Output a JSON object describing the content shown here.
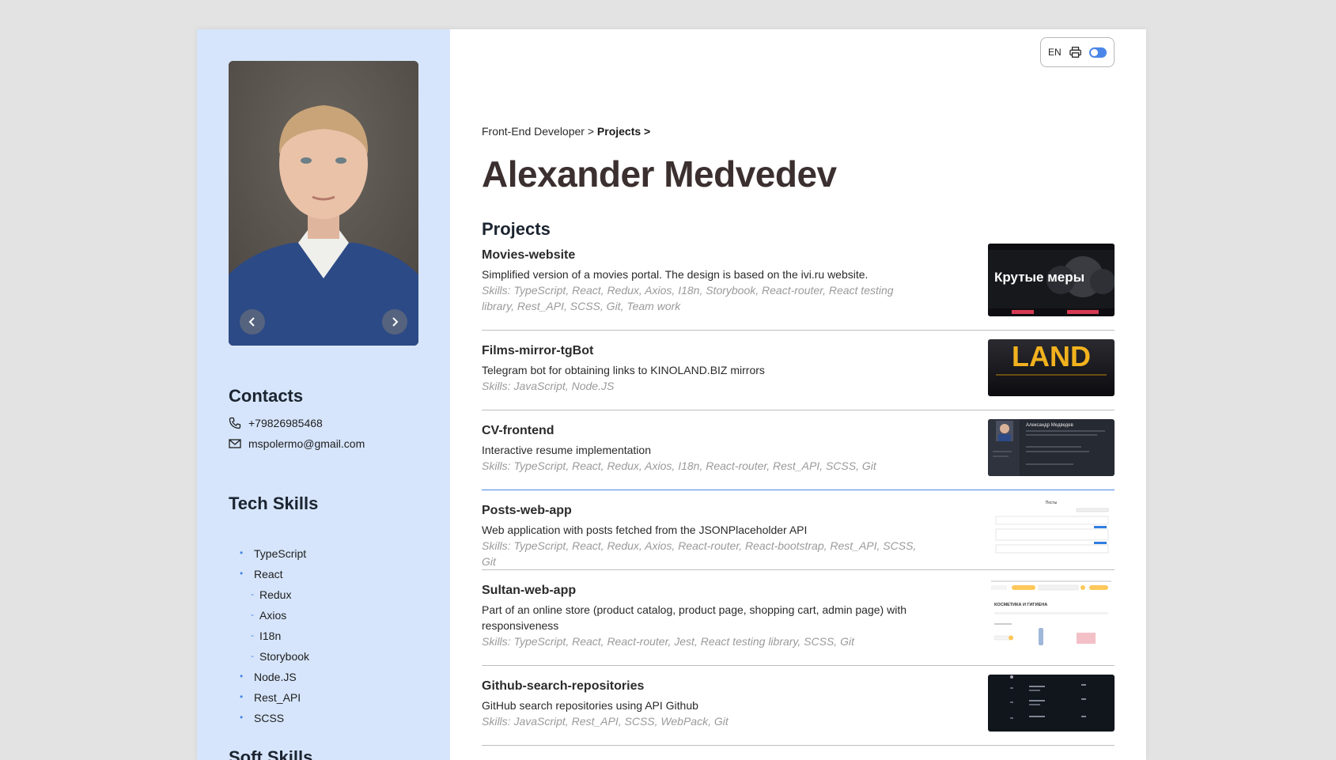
{
  "toolbar": {
    "lang": "EN",
    "print_icon": "printer-icon",
    "theme_toggle": "on"
  },
  "breadcrumb": {
    "root": "Front-End Developer >",
    "current": "Projects >"
  },
  "name": "Alexander Medvedev",
  "contacts": {
    "title": "Contacts",
    "phone": "+79826985468",
    "email": "mspolermo@gmail.com"
  },
  "tech_skills": {
    "title": "Tech Skills",
    "items": [
      "TypeScript",
      "React",
      "Redux",
      "Axios",
      "I18n",
      "Storybook",
      "Node.JS",
      "Rest_API",
      "SCSS"
    ]
  },
  "soft_skills": {
    "title": "Soft Skills"
  },
  "projects": {
    "title": "Projects",
    "items": [
      {
        "title": "Movies-website",
        "desc": "Simplified version of a movies portal. The design is based on the ivi.ru website.",
        "skills": "Skills: TypeScript, React, Redux, Axios, I18n, Storybook, React-router, React testing library, Rest_API, SCSS, Git, Team work",
        "thumb_text": "Крутые меры"
      },
      {
        "title": "Films-mirror-tgBot",
        "desc": "Telegram bot for obtaining links to KINOLAND.BIZ mirrors",
        "skills": "Skills: JavaScript, Node.JS",
        "thumb_text": "LAND"
      },
      {
        "title": "CV-frontend",
        "desc": "Interactive resume implementation",
        "skills": "Skills: TypeScript, React, Redux, Axios, I18n, React-router, Rest_API, SCSS, Git",
        "thumb_text": "Александр Медведев"
      },
      {
        "title": "Posts-web-app",
        "desc": "Web application with posts fetched from the JSONPlaceholder API",
        "skills": "Skills: TypeScript, React, Redux, Axios, React-router, React-bootstrap, Rest_API, SCSS, Git",
        "thumb_text": "Посты"
      },
      {
        "title": "Sultan-web-app",
        "desc": "Part of an online store (product catalog, product page, shopping cart, admin page) with responsiveness",
        "skills": "Skills: TypeScript, React, React-router, Jest, React testing library, SCSS, Git",
        "thumb_text": "КОСМЕТИКА И ГИГИЕНА"
      },
      {
        "title": "Github-search-repositories",
        "desc": "GitHub search repositories using API Github",
        "skills": "Skills: JavaScript, Rest_API, SCSS, WebPack, Git",
        "thumb_text": ""
      }
    ]
  },
  "colors": {
    "accent": "#4a86e8",
    "sidebar": "#d6e5fb",
    "name": "#3b2f2f",
    "skills": "#9a9a9a"
  }
}
